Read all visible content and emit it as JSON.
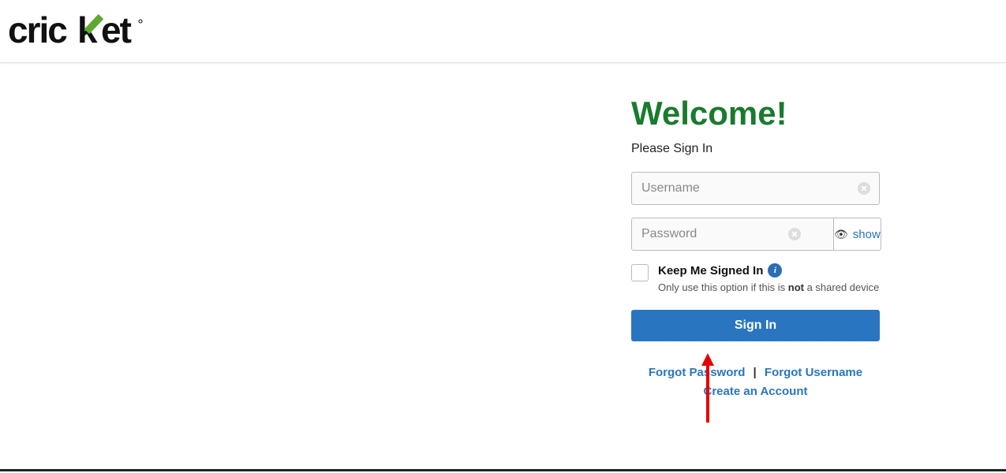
{
  "brand": "cricket",
  "welcome": "Welcome!",
  "subtitle": "Please Sign In",
  "username": {
    "placeholder": "Username",
    "value": ""
  },
  "password": {
    "placeholder": "Password",
    "value": "",
    "show_label": "show"
  },
  "keep": {
    "label": "Keep Me Signed In",
    "hint_prefix": "Only use this option if this is ",
    "hint_bold": "not",
    "hint_suffix": " a shared device"
  },
  "signin": "Sign In",
  "links": {
    "forgot_pw": "Forgot Password",
    "forgot_un": "Forgot Username",
    "create": "Create an Account"
  },
  "colors": {
    "brand_green": "#1a7a2e",
    "accent_blue": "#2a75c0"
  }
}
